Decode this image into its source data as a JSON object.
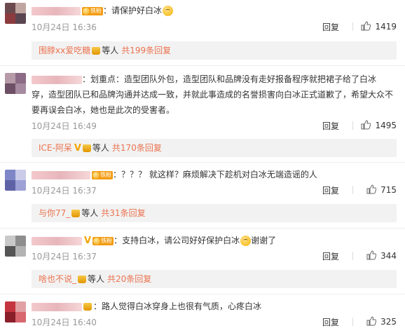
{
  "comments": [
    {
      "text": "请保护好白冰",
      "date": "10月24日 16:36",
      "reply_label": "回复",
      "likes": "1419",
      "badge": "铁粉",
      "sub": {
        "who": "围脖xx爱吃糖",
        "etc": "等人",
        "count": "共199条回复"
      }
    },
    {
      "text_lines": [
        "划重点：造型团队外包，造型团队和品牌没有走好报备程序就把裙子给了白冰",
        "穿，造型团队已和品牌沟通并达成一致，并就此事造成的名誉损害向白冰正式道歉了，希望大众不",
        "要再误会白冰，她也是此次的受害者。"
      ],
      "date": "10月24日 16:49",
      "reply_label": "回复",
      "likes": "1495",
      "sub": {
        "who": "ICE-阿呆",
        "etc": "等人",
        "count": "共170条回复"
      }
    },
    {
      "text": "？？？ 就这样？麻烦解决下趁机对白冰无端造谣的人",
      "date": "10月24日 16:37",
      "reply_label": "回复",
      "likes": "715",
      "badge": "铁粉",
      "sub": {
        "who": "与你77_",
        "etc": "等人",
        "count": "共31条回复"
      }
    },
    {
      "text": "支持白冰，请公司好好保护白冰",
      "text_after": "谢谢了",
      "date": "10月24日 16:37",
      "reply_label": "回复",
      "likes": "344",
      "badge": "铁粉",
      "sub": {
        "who": "啥也不说_",
        "etc": "等人",
        "count": "共20条回复"
      }
    },
    {
      "text": "路人觉得白冰穿身上也很有气质，心疼白冰",
      "date": "10月24日 16:40",
      "reply_label": "回复",
      "likes": "325"
    }
  ],
  "icons": {
    "like": "thumbs-up-icon",
    "emoji": "cry-face-emoji-icon",
    "crown": "crown-icon",
    "verified": "v-verified-icon"
  },
  "colors": {
    "link": "#eb7350",
    "meta": "#999999",
    "subbg": "#f2f2f2",
    "badge": "#f39c12"
  }
}
